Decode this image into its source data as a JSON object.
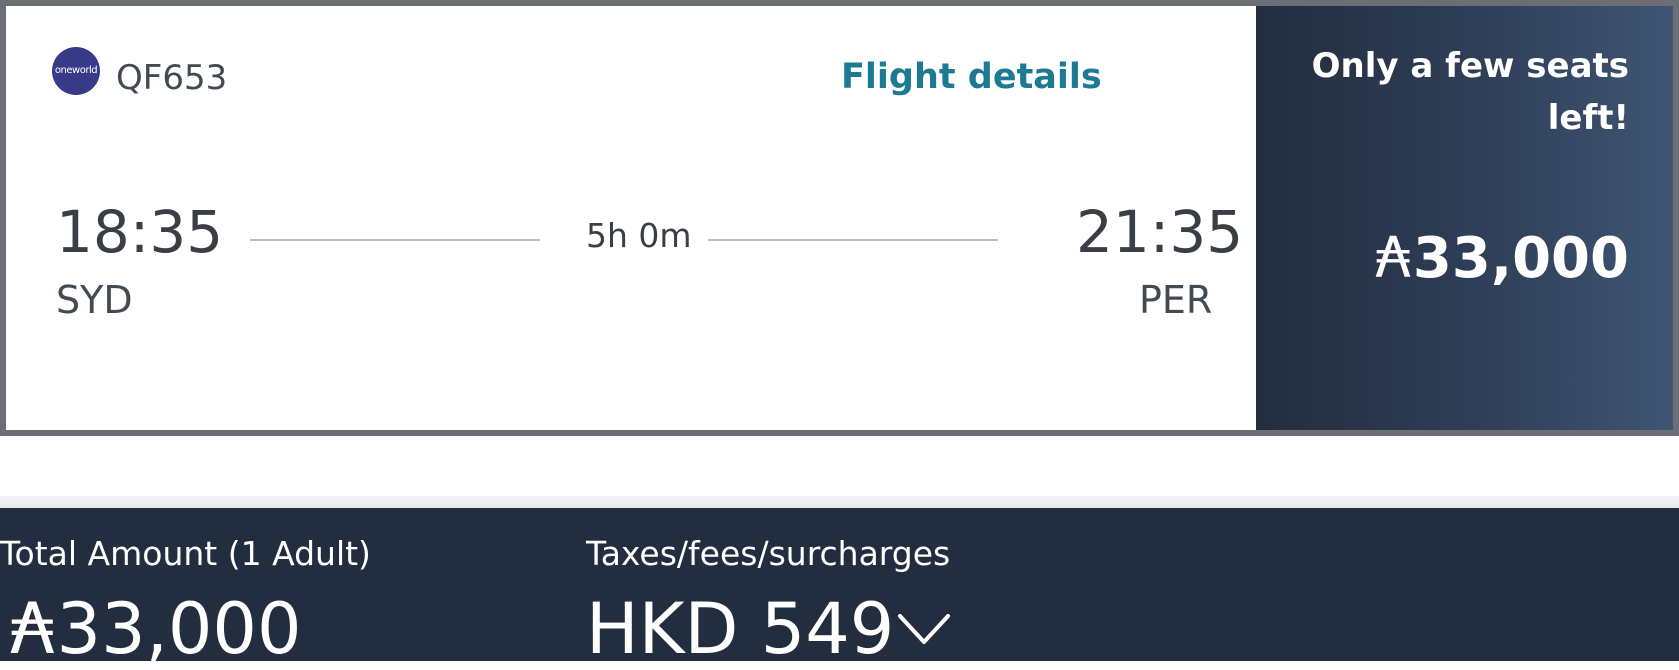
{
  "flight": {
    "alliance_logo_text": "oneworld",
    "number": "QF653",
    "details_link": "Flight details",
    "departure": {
      "time": "18:35",
      "airport": "SYD"
    },
    "arrival": {
      "time": "21:35",
      "airport": "PER"
    },
    "duration": "5h 0m"
  },
  "fare": {
    "availability_message": "Only a few seats left!",
    "currency_icon": "qantas-points-icon",
    "points": "33,000"
  },
  "summary": {
    "total_label": "Total Amount (1 Adult)",
    "total_points": "33,000",
    "taxes_label": "Taxes/fees/surcharges",
    "taxes_value": "HKD 549",
    "expand_icon": "chevron-down-icon"
  },
  "colors": {
    "card_border": "#6b6e73",
    "link": "#1c7a93",
    "panel_dark": "#222d3f",
    "panel_light": "#3e5574",
    "oneworld_logo": "#363a89"
  }
}
